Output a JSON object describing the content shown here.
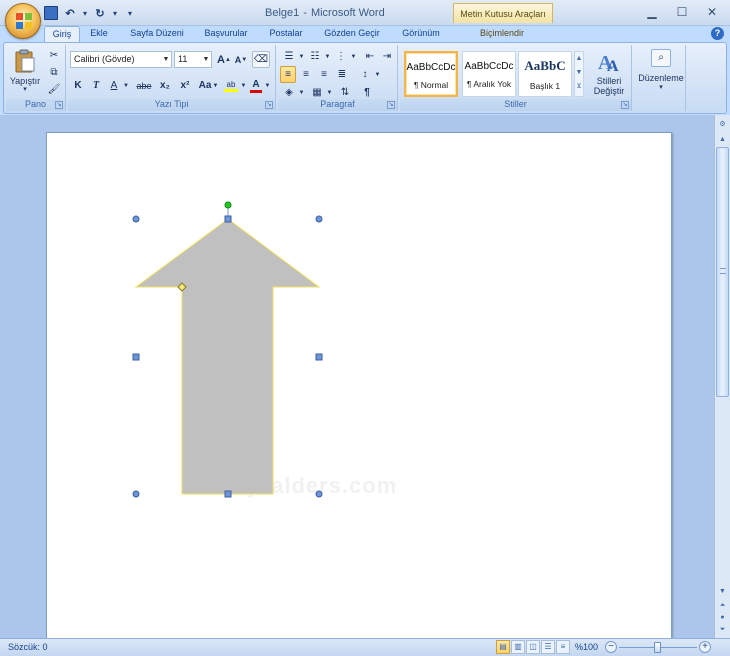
{
  "window": {
    "title_doc": "Belge1",
    "title_sep": "-",
    "title_app": "Microsoft Word",
    "context_tab_title": "Metin Kutusu Araçları",
    "minimize": "▁",
    "maximize": "☐",
    "close": "✕"
  },
  "qat": {
    "save_glyph": "💾",
    "undo_glyph": "↶",
    "redo_glyph": "↻",
    "customize_glyph": "▾"
  },
  "tabs": [
    {
      "label": "Giriş"
    },
    {
      "label": "Ekle"
    },
    {
      "label": "Sayfa Düzeni"
    },
    {
      "label": "Başvurular"
    },
    {
      "label": "Postalar"
    },
    {
      "label": "Gözden Geçir"
    },
    {
      "label": "Görünüm"
    },
    {
      "label": "Biçimlendir"
    }
  ],
  "help": "?",
  "ribbon": {
    "clipboard": {
      "label": "Pano",
      "paste_label": "Yapıştır",
      "paste_arrow": "▾"
    },
    "font": {
      "label": "Yazı Tipi",
      "font_name": "Calibri (Gövde)",
      "font_size": "11",
      "grow": "A",
      "shrink": "A",
      "bold": "K",
      "italic": "T",
      "underline": "A",
      "strike": "abe",
      "subscript": "x₂",
      "superscript": "x²",
      "change_case": "Aa",
      "highlight": "ab",
      "font_color": "A"
    },
    "paragraph": {
      "label": "Paragraf"
    },
    "styles": {
      "label": "Stiller",
      "tiles": [
        {
          "sample": "AaBbCcDc",
          "name": "¶ Normal"
        },
        {
          "sample": "AaBbCcDc",
          "name": "¶ Aralık Yok"
        },
        {
          "sample": "AaBbC",
          "name": "Başlık 1"
        }
      ],
      "change_styles_line1": "Stilleri",
      "change_styles_line2": "Değiştir"
    },
    "editing": {
      "label": "Düzenleme"
    }
  },
  "document": {
    "watermark": "dijitalders.com"
  },
  "statusbar": {
    "words": "Sözcük: 0",
    "zoom": "%100",
    "zoom_minus": "−",
    "zoom_plus": "+"
  },
  "colors": {
    "arrow_fill": "#c0c0c0",
    "arrow_stroke": "#f0e060",
    "handle_fill": "#6f95d6",
    "rotate_handle": "#22cc22",
    "adjust_handle": "#f5e87a"
  }
}
